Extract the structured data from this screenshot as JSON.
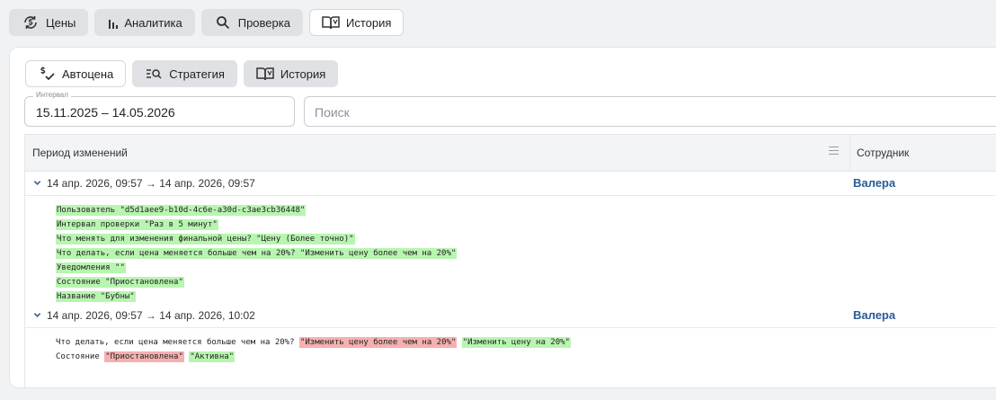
{
  "top_nav": {
    "prices": "Цены",
    "analytics": "Аналитика",
    "check": "Проверка",
    "history": "История"
  },
  "sub_nav": {
    "autoprice": "Автоцена",
    "strategy": "Стратегия",
    "history": "История"
  },
  "interval": {
    "label": "Интервал",
    "value": "15.11.2025 – 14.05.2026"
  },
  "search": {
    "placeholder": "Поиск"
  },
  "table": {
    "col_period": "Период изменений",
    "col_employee": "Сотрудник"
  },
  "groups": [
    {
      "period": "14 апр. 2026, 09:57 → 14 апр. 2026, 09:57",
      "user": "Валера",
      "lines": [
        {
          "label": "",
          "added": "Пользователь \"d5d1aee9-b10d-4c6e-a30d-c3ae3cb36448\""
        },
        {
          "label": "",
          "added": "Интервал проверки \"Раз в 5 минут\""
        },
        {
          "label": "",
          "added": "Что менять для изменения финальной цены? \"Цену (Более точно)\""
        },
        {
          "label": "",
          "added": "Что делать, если цена меняется больше чем на 20%? \"Изменить цену более чем на 20%\""
        },
        {
          "label": "",
          "added": "Уведомления \"\""
        },
        {
          "label": "",
          "added": "Состояние \"Приостановлена\""
        },
        {
          "label": "",
          "added": "Название \"Бубны\""
        }
      ]
    },
    {
      "period": "14 апр. 2026, 09:57 → 14 апр. 2026, 10:02",
      "user": "Валера",
      "lines": [
        {
          "label": "Что делать, если цена меняется больше чем на 20%?",
          "removed": "\"Изменить цену более чем на 20%\"",
          "added": "\"Изменить цену на 20%\""
        },
        {
          "label": "Состояние",
          "removed": "\"Приостановлена\"",
          "added": "\"Активна\""
        }
      ]
    }
  ]
}
